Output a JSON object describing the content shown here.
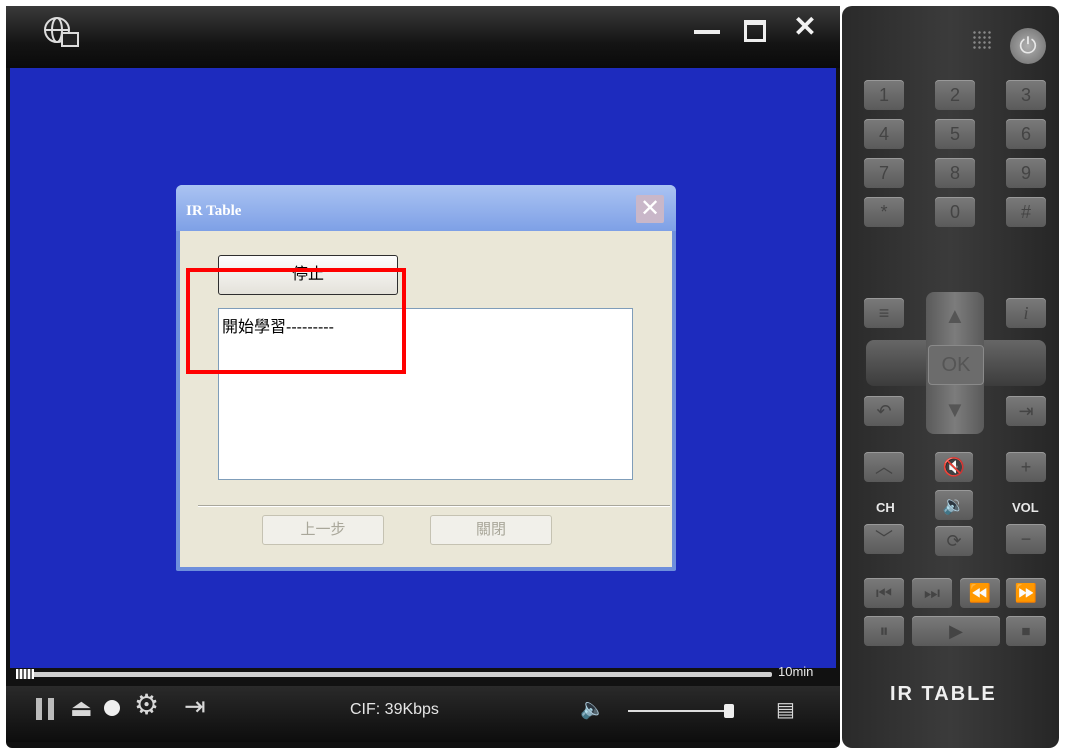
{
  "player": {
    "progress_label": "10min",
    "status_text": "CIF: 39Kbps"
  },
  "dialog": {
    "title": "IR Table",
    "stop_label": "停止",
    "log_text": "開始學習---------",
    "prev_label": "上一步",
    "close_label": "關閉",
    "close_glyph": "✕"
  },
  "remote": {
    "digits": [
      "1",
      "2",
      "3",
      "4",
      "5",
      "6",
      "7",
      "8",
      "9",
      "*",
      "0",
      "#"
    ],
    "ok_label": "OK",
    "ch_label": "CH",
    "vol_label": "VOL",
    "logo": "IR TABLE",
    "power_glyph": "⏻",
    "info_glyph": "i"
  },
  "icons": {
    "app": "globe-screen-icon",
    "minimize": "minimize-icon",
    "maximize": "maximize-icon",
    "close": "close-icon"
  },
  "colors": {
    "video_bg": "#1d2bbe",
    "dialog_bg": "#eae7d7",
    "highlight": "#ff0000"
  }
}
